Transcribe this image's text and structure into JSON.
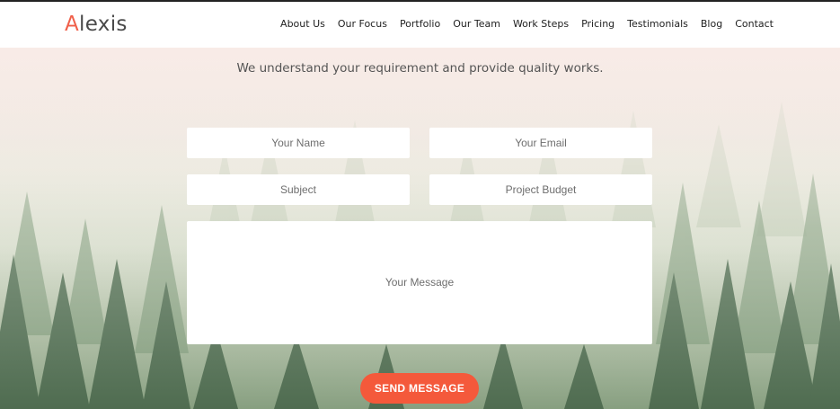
{
  "brand": {
    "first_letter": "A",
    "rest": "lexis"
  },
  "nav": {
    "items": [
      "About Us",
      "Our Focus",
      "Portfolio",
      "Our Team",
      "Work Steps",
      "Pricing",
      "Testimonials",
      "Blog",
      "Contact"
    ]
  },
  "contact": {
    "tagline": "We understand your requirement and provide quality works.",
    "name_placeholder": "Your Name",
    "email_placeholder": "Your Email",
    "subject_placeholder": "Subject",
    "budget_placeholder": "Project Budget",
    "message_placeholder": "Your Message",
    "send_label": "SEND MESSAGE"
  },
  "colors": {
    "accent": "#f4593b",
    "logo_accent": "#f0604a",
    "text": "#222222"
  }
}
